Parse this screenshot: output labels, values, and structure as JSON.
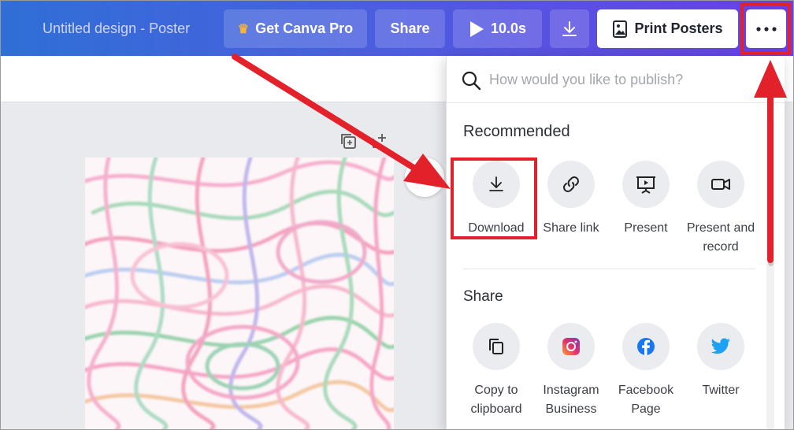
{
  "header": {
    "doc_title": "Untitled design - Poster",
    "get_pro_label": "Get Canva Pro",
    "share_label": "Share",
    "duration_label": "10.0s",
    "print_label": "Print Posters"
  },
  "publish_panel": {
    "search_placeholder": "How would you like to publish?",
    "recommended": {
      "title": "Recommended",
      "items": [
        {
          "label": "Download",
          "icon": "download-icon"
        },
        {
          "label": "Share link",
          "icon": "link-icon"
        },
        {
          "label": "Present",
          "icon": "present-icon"
        },
        {
          "label": "Present and record",
          "icon": "camera-icon"
        }
      ]
    },
    "share": {
      "title": "Share",
      "items": [
        {
          "label": "Copy to clipboard",
          "icon": "copy-icon"
        },
        {
          "label": "Instagram Business",
          "icon": "instagram-icon"
        },
        {
          "label": "Facebook Page",
          "icon": "facebook-icon"
        },
        {
          "label": "Twitter",
          "icon": "twitter-icon"
        }
      ]
    }
  },
  "colors": {
    "annotation_red": "#e3212b",
    "facebook_blue": "#1877f2",
    "twitter_blue": "#1da1f2"
  }
}
